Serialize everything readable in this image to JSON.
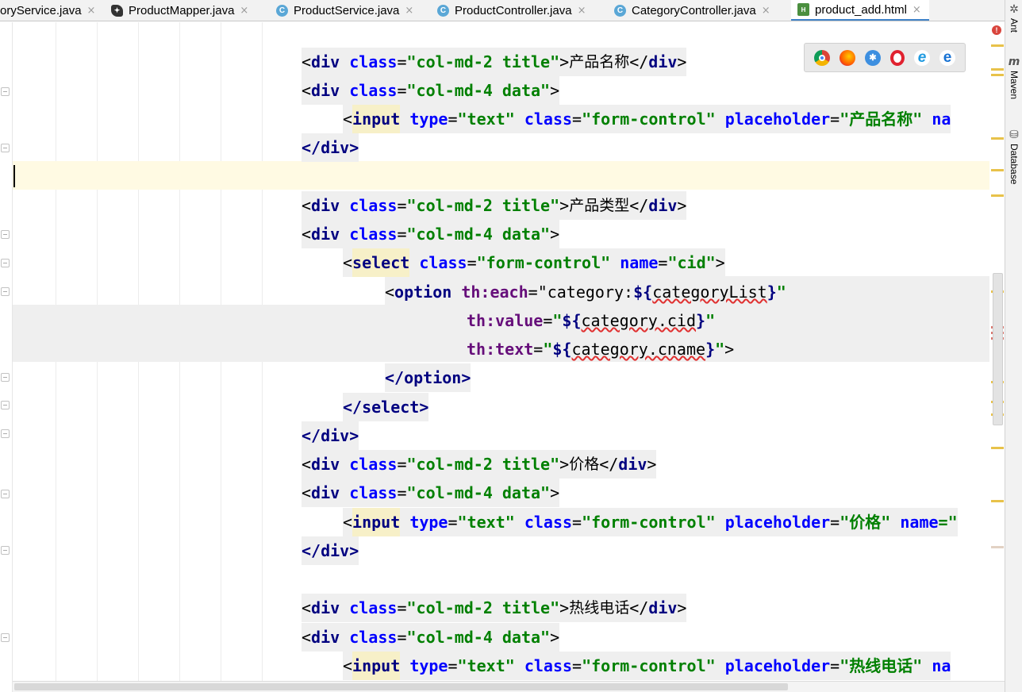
{
  "tabs": [
    {
      "label": "oryService.java",
      "icon": "none"
    },
    {
      "label": "ProductMapper.java",
      "icon": "mybatis-icon"
    },
    {
      "label": "ProductService.java",
      "icon": "class-icon"
    },
    {
      "label": "ProductController.java",
      "icon": "class-icon"
    },
    {
      "label": "CategoryController.java",
      "icon": "class-icon"
    },
    {
      "label": "product_add.html",
      "icon": "html-file-icon",
      "active": true
    }
  ],
  "tab_close": "×",
  "class_icon_letter": "C",
  "html_icon_letter": "H",
  "browsers": [
    "chrome-icon",
    "firefox-icon",
    "safari-icon",
    "opera-icon",
    "ie-icon",
    "edge-icon"
  ],
  "right_tools": [
    {
      "label": "Ant",
      "icon": "ant-icon"
    },
    {
      "label": "Maven",
      "icon": "maven-icon"
    },
    {
      "label": "Database",
      "icon": "database-icon"
    }
  ],
  "code": {
    "l1": {
      "open": "<",
      "tag": "div",
      "attr": "class",
      "eq": "=",
      "val": "\"col-md-2 title\"",
      "close": ">",
      "text": "产品名称",
      "end_open": "</",
      "end_tag": "div",
      "end_close": ">"
    },
    "l2": {
      "open": "<",
      "tag": "div",
      "attr": "class",
      "eq": "=",
      "val": "\"col-md-4 data\"",
      "close": ">"
    },
    "l3": {
      "open": "<",
      "tag": "input",
      "attr1": "type",
      "val1": "\"text\"",
      "attr2": "class",
      "val2": "\"form-control\"",
      "attr3": "placeholder",
      "val3": "\"产品名称\"",
      "attr4": "na"
    },
    "l4": {
      "text": "</div>"
    },
    "l6": {
      "open": "<",
      "tag": "div",
      "attr": "class",
      "eq": "=",
      "val": "\"col-md-2 title\"",
      "close": ">",
      "text": "产品类型",
      "end_open": "</",
      "end_tag": "div",
      "end_close": ">"
    },
    "l7": {
      "open": "<",
      "tag": "div",
      "attr": "class",
      "eq": "=",
      "val": "\"col-md-4 data\"",
      "close": ">"
    },
    "l8": {
      "open": "<",
      "tag": "select",
      "attr1": "class",
      "val1": "\"form-control\"",
      "attr2": "name",
      "val2": "\"cid\"",
      "close": ">"
    },
    "l9": {
      "open": "<",
      "tag": "option",
      "attr": "th:each",
      "eq": "=",
      "q1": "\"category:",
      "expr_open": "${",
      "expr": "categoryList",
      "expr_close": "}",
      "q2": "\""
    },
    "l10": {
      "attr": "th:value",
      "eq": "=",
      "q1": "\"",
      "expr_open": "${",
      "expr": "category.cid",
      "expr_close": "}",
      "q2": "\""
    },
    "l11": {
      "attr": "th:text",
      "eq": "=",
      "q1": "\"",
      "expr_open": "${",
      "expr": "category.cname",
      "expr_close": "}",
      "q2": "\"",
      "close": ">"
    },
    "l12": {
      "text": "</option>"
    },
    "l13": {
      "text": "</select>"
    },
    "l14": {
      "text": "</div>"
    },
    "l15": {
      "open": "<",
      "tag": "div",
      "attr": "class",
      "eq": "=",
      "val": "\"col-md-2 title\"",
      "close": ">",
      "text": "价格",
      "end_open": "</",
      "end_tag": "div",
      "end_close": ">"
    },
    "l16": {
      "open": "<",
      "tag": "div",
      "attr": "class",
      "eq": "=",
      "val": "\"col-md-4 data\"",
      "close": ">"
    },
    "l17": {
      "open": "<",
      "tag": "input",
      "attr1": "type",
      "val1": "\"text\"",
      "attr2": "class",
      "val2": "\"form-control\"",
      "attr3": "placeholder",
      "val3": "\"价格\"",
      "attr4": "name",
      "tail": "=\""
    },
    "l18": {
      "text": "</div>"
    },
    "l20": {
      "open": "<",
      "tag": "div",
      "attr": "class",
      "eq": "=",
      "val": "\"col-md-2 title\"",
      "close": ">",
      "text": "热线电话",
      "end_open": "</",
      "end_tag": "div",
      "end_close": ">"
    },
    "l21": {
      "open": "<",
      "tag": "div",
      "attr": "class",
      "eq": "=",
      "val": "\"col-md-4 data\"",
      "close": ">"
    },
    "l22": {
      "open": "<",
      "tag": "input",
      "attr1": "type",
      "val1": "\"text\"",
      "attr2": "class",
      "val2": "\"form-control\"",
      "attr3": "placeholder",
      "val3": "\"热线电话\"",
      "attr4": "na"
    }
  },
  "colors": {
    "tag": "#000080",
    "attr": "#0000ff",
    "value": "#008000",
    "thymeleaf": "#660e7a",
    "current_line": "#fffae3",
    "error": "#d9453d",
    "active_tab_underline": "#4083c9"
  }
}
